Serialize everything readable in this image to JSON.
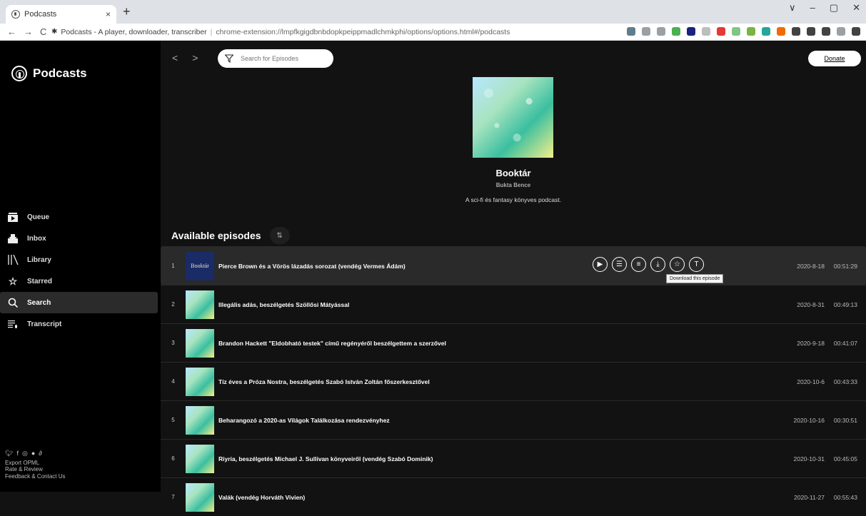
{
  "browser": {
    "tab_title": "Podcasts",
    "tab_close": "×",
    "new_tab": "+",
    "window_controls": [
      "∨",
      "–",
      "▢",
      "✕"
    ],
    "nav": {
      "back": "←",
      "forward": "→",
      "reload": "C"
    },
    "url_site": "Podcasts - A player, downloader, transcriber",
    "url_path": "chrome-extension://lmpfkgigdbnbdopkpeippmadlchmkphi/options/options.html#/podcasts",
    "ext_colors": [
      "#607d8b",
      "#9aa0a6",
      "#9aa0a6",
      "#4caf50",
      "#1a237e",
      "#bdbdbd",
      "#e53935",
      "#81c784",
      "#7cb342",
      "#26a69a",
      "#ef6c00",
      "#424242",
      "#424242",
      "#424242",
      "#9aa0a6",
      "#424242"
    ]
  },
  "sidebar": {
    "app_name": "Podcasts",
    "items": [
      {
        "label": "Queue",
        "icon": "queue-icon"
      },
      {
        "label": "Inbox",
        "icon": "inbox-icon"
      },
      {
        "label": "Library",
        "icon": "library-icon"
      },
      {
        "label": "Starred",
        "icon": "star-icon"
      },
      {
        "label": "Search",
        "icon": "search-icon",
        "active": true
      },
      {
        "label": "Transcript",
        "icon": "transcript-icon"
      }
    ],
    "footer": {
      "social": [
        "twitter-icon",
        "facebook-icon",
        "instagram-icon",
        "github-icon",
        "link-icon"
      ],
      "export": "Export OPML",
      "rate": "Rate & Review",
      "feedback": "Feedback & Contact Us"
    }
  },
  "main": {
    "nav_back": "<",
    "nav_forward": ">",
    "search_placeholder": "Search for Episodes",
    "donate_label": "Donate",
    "podcast": {
      "title": "Booktár",
      "author": "Bukta Bence",
      "description": "A sci-fi és fantasy könyves podcast."
    },
    "episodes_heading": "Available episodes",
    "sort_icon": "⇅",
    "tooltip": "Download this episode",
    "episodes": [
      {
        "num": "1",
        "title": "Pierce Brown és a Vörös lázadás sorozat (vendég Vermes Ádám)",
        "date": "2020-8-18",
        "duration": "00:51:29",
        "thumb_text": "Booktár"
      },
      {
        "num": "2",
        "title": "Illegális adás, beszélgetés Szöllősi Mátyással",
        "date": "2020-8-31",
        "duration": "00:49:13"
      },
      {
        "num": "3",
        "title": "Brandon Hackett \"Eldobható testek\" című regényéről beszélgettem a szerzővel",
        "date": "2020-9-18",
        "duration": "00:41:07"
      },
      {
        "num": "4",
        "title": "Tíz éves a Próza Nostra, beszélgetés Szabó István Zoltán főszerkesztővel",
        "date": "2020-10-6",
        "duration": "00:43:33"
      },
      {
        "num": "5",
        "title": "Beharangozó a 2020-as Világok Találkozása rendezvényhez",
        "date": "2020-10-16",
        "duration": "00:30:51"
      },
      {
        "num": "6",
        "title": "Riyria, beszélgetés Michael J. Sullivan könyveiről (vendég Szabó Dominik)",
        "date": "2020-10-31",
        "duration": "00:45:05"
      },
      {
        "num": "7",
        "title": "Valák (vendég Horváth Vivien)",
        "date": "2020-11-27",
        "duration": "00:55:43"
      }
    ]
  }
}
